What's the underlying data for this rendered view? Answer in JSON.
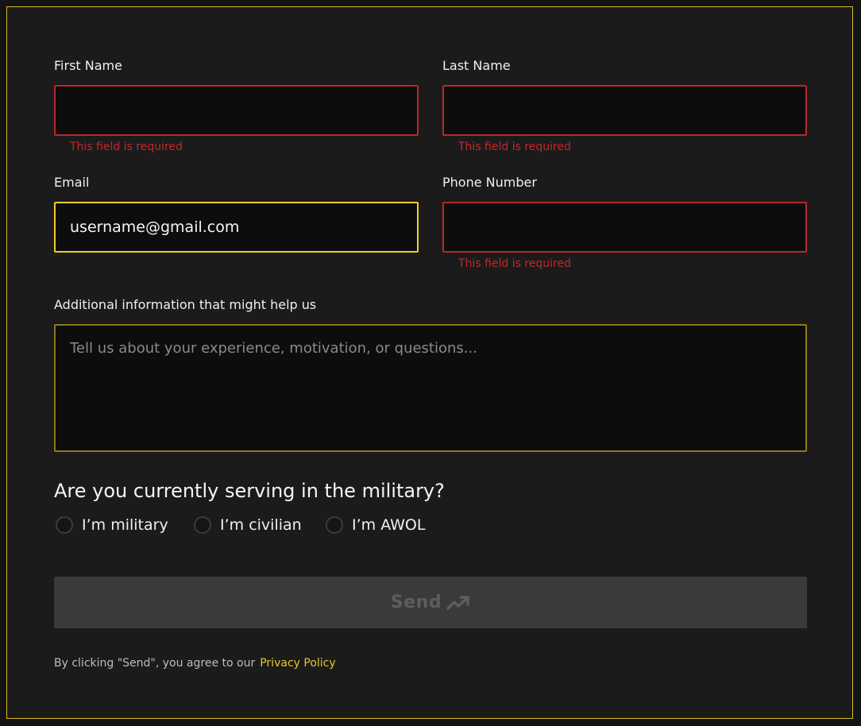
{
  "form": {
    "first_name": {
      "label": "First Name",
      "value": "",
      "error": "This field is required"
    },
    "last_name": {
      "label": "Last Name",
      "value": "",
      "error": "This field is required"
    },
    "email": {
      "label": "Email",
      "value": "username@gmail.com"
    },
    "phone": {
      "label": "Phone Number",
      "value": "",
      "error": "This field is required"
    },
    "additional": {
      "label": "Additional information that might help us",
      "placeholder": "Tell us about your experience, motivation, or questions..."
    },
    "question": "Are you currently serving in the military?",
    "options": [
      "I’m military",
      "I’m civilian",
      "I’m AWOL"
    ],
    "send_label": "Send",
    "legal_text": "By clicking \"Send\", you agree to our",
    "privacy_link": "Privacy Policy"
  },
  "colors": {
    "accent": "#e9c72c",
    "error": "#c0292b",
    "background": "#1b1b1b",
    "field_bg": "#0d0d0d",
    "disabled_button": "#3a3a3a"
  },
  "icons": {
    "send": "trending-up-icon"
  }
}
